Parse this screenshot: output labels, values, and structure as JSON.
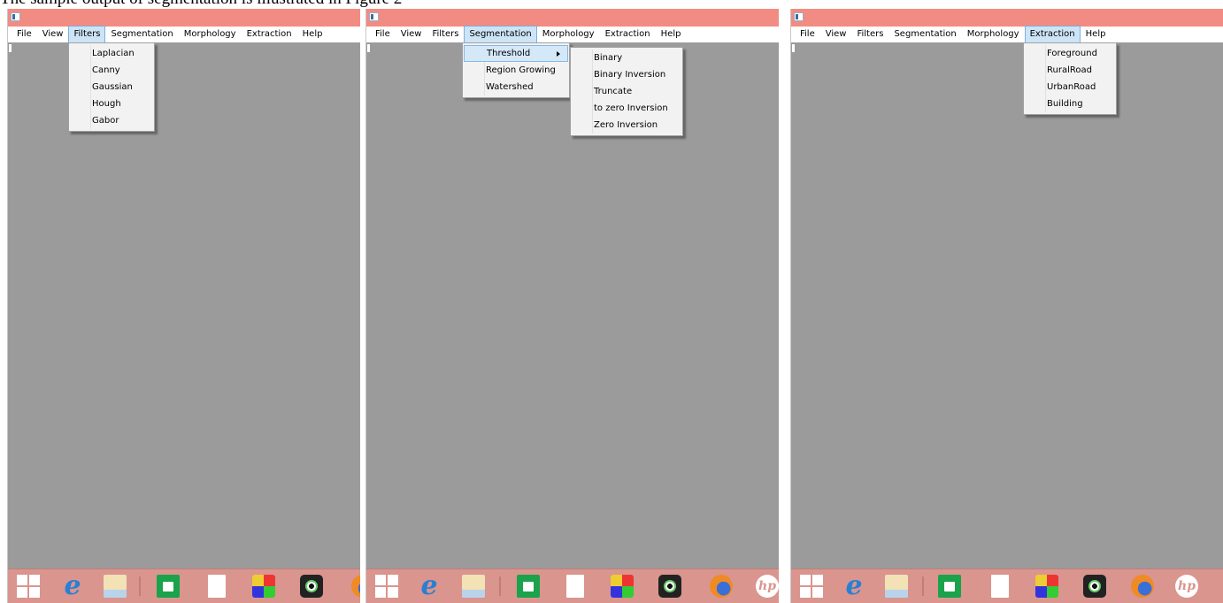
{
  "caption": "The sample output of segmentation is illustrated in Figure 2",
  "colors": {
    "titlebar": "#f28b82",
    "client": "#9b9b9b",
    "taskbar": "#d9958e",
    "menu_highlight": "#cde4f7"
  },
  "menu": [
    "File",
    "View",
    "Filters",
    "Segmentation",
    "Morphology",
    "Extraction",
    "Help"
  ],
  "panels": [
    {
      "active_menu": "Filters",
      "dropdown": [
        "Laplacian",
        "Canny",
        "Gaussian",
        "Hough",
        "Gabor"
      ]
    },
    {
      "active_menu": "Segmentation",
      "dropdown": [
        "Threshold",
        "Region Growing",
        "Watershed"
      ],
      "submenu": [
        "Binary",
        "Binary Inversion",
        "Truncate",
        "to zero Inversion",
        "Zero Inversion"
      ]
    },
    {
      "active_menu": "Extraction",
      "dropdown": [
        "Foreground",
        "RuralRoad",
        "UrbanRoad",
        "Building"
      ]
    }
  ],
  "taskbar_icons": [
    "windows-start-icon",
    "internet-explorer-icon",
    "file-explorer-icon",
    "store-icon",
    "document-icon",
    "paint-icon",
    "webcam-icon",
    "firefox-icon",
    "hp-icon"
  ],
  "hp_label": "hp"
}
